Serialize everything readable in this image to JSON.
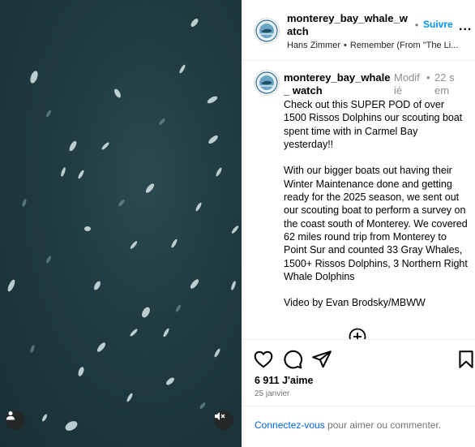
{
  "post": {
    "username": "monterey_bay_whale_watch",
    "follow_label": "Suivre",
    "separator": "•",
    "more_label": "...",
    "audio_artist": "Hans Zimmer",
    "audio_title": "Remember (From \"The Li..."
  },
  "caption": {
    "username_display": "monterey_bay_whale_ watch",
    "edited_label": "Modif ié",
    "separator": "•",
    "time_ago": "22 sem",
    "text": "Check out this SUPER POD of over 1500 Rissos Dolphins our scouting boat spent time with in Carmel Bay yesterday!!\n\nWith our bigger boats out having their Winter Maintenance done and getting ready for the 2025 season, we sent out our scouting boat to perform a survey on the coast south of Monterey. We covered 62 miles round trip from Monterey to Point Sur and counted 33 Gray Whales, 1500+ Rissos Dolphins, 3 Northern Right Whale Dolphins\n\nVideo by Evan Brodsky/MBWW"
  },
  "stats": {
    "likes": "6 911 J'aime",
    "date": "25 janvier"
  },
  "login": {
    "link": "Connectez-vous",
    "text": " pour aimer ou commenter."
  },
  "icons": {
    "media": [
      "user-tag-icon",
      "mute-icon"
    ],
    "actions": [
      "heart-icon",
      "comment-icon",
      "share-icon",
      "bookmark-icon"
    ],
    "load_more": "plus-circle-icon"
  },
  "colors": {
    "follow": "#0095f6",
    "link": "#0064e0",
    "water": "#1f3a40",
    "muted_text": "#737373"
  }
}
